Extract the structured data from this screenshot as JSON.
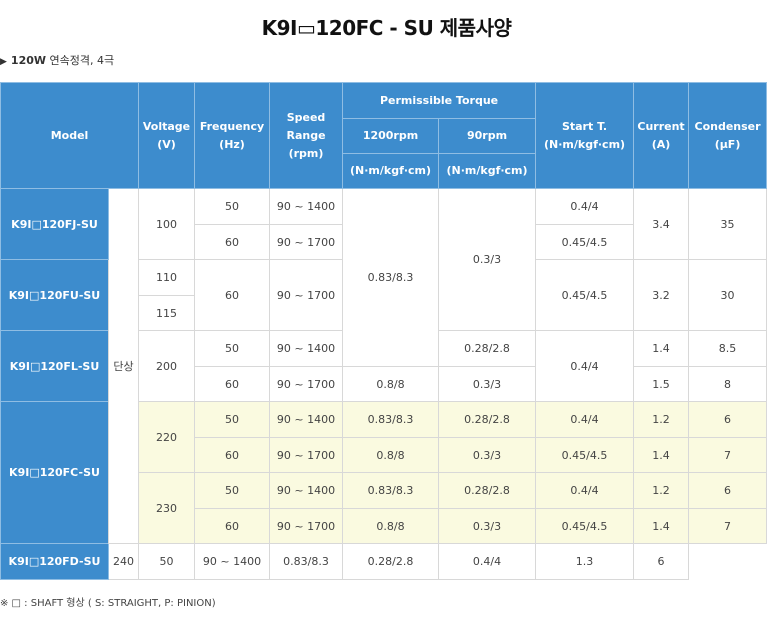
{
  "title": "K9I▭120FC - SU 제품사양",
  "subtitle": {
    "power": "120W",
    "desc": "연속정격, 4극"
  },
  "headers": {
    "model": "Model",
    "voltage": "Voltage",
    "voltage_unit": "(V)",
    "frequency": "Frequency",
    "frequency_unit": "(Hz)",
    "speed": "Speed",
    "speed_range": "Range",
    "speed_unit": "(rpm)",
    "permissible_torque": "Permissible Torque",
    "torque_1200": "1200rpm",
    "torque_90": "90rpm",
    "torque_unit_1200": "(N·m/kgf·cm)",
    "torque_unit_90": "(N·m/kgf·cm)",
    "start_t": "Start T.",
    "start_t_unit": "(N·m/kgf·cm)",
    "current": "Current",
    "current_unit": "(A)",
    "condenser": "Condenser",
    "condenser_unit": "(μF)"
  },
  "phase": "단상",
  "models": {
    "fj": "K9I□120FJ-SU",
    "fu": "K9I□120FU-SU",
    "fl": "K9I□120FL-SU",
    "fc": "K9I□120FC-SU",
    "fd": "K9I□120FD-SU"
  },
  "cells": {
    "fj_v": "100",
    "fj_f1": "50",
    "fj_s1": "90 ~ 1400",
    "fj_st1": "0.4/4",
    "fj_f2": "60",
    "fj_s2": "90 ~ 1700",
    "fj_st2": "0.45/4.5",
    "fj_cur": "3.4",
    "fj_cond": "35",
    "t1200_big": "0.83/8.3",
    "t90_big": "0.3/3",
    "fu_v1": "110",
    "fu_v2": "115",
    "fu_f": "60",
    "fu_s": "90 ~ 1700",
    "fu_st": "0.45/4.5",
    "fu_cur": "3.2",
    "fu_cond": "30",
    "fl_v": "200",
    "fl_f1": "50",
    "fl_s1": "90 ~ 1400",
    "fl_t90_1": "0.28/2.8",
    "fl_cur1": "1.4",
    "fl_cond1": "8.5",
    "fl_f2": "60",
    "fl_s2": "90 ~ 1700",
    "fl_t1200_2": "0.8/8",
    "fl_t90_2": "0.3/3",
    "fl_cur2": "1.5",
    "fl_cond2": "8",
    "fl_st": "0.4/4",
    "fc_v1": "220",
    "fc_r1_f": "50",
    "fc_r1_s": "90 ~ 1400",
    "fc_r1_t1200": "0.83/8.3",
    "fc_r1_t90": "0.28/2.8",
    "fc_r1_st": "0.4/4",
    "fc_r1_cur": "1.2",
    "fc_r1_cond": "6",
    "fc_r2_f": "60",
    "fc_r2_s": "90 ~ 1700",
    "fc_r2_t1200": "0.8/8",
    "fc_r2_t90": "0.3/3",
    "fc_r2_st": "0.45/4.5",
    "fc_r2_cur": "1.4",
    "fc_r2_cond": "7",
    "fc_v2": "230",
    "fc_r3_f": "50",
    "fc_r3_s": "90 ~ 1400",
    "fc_r3_t1200": "0.83/8.3",
    "fc_r3_t90": "0.28/2.8",
    "fc_r3_st": "0.4/4",
    "fc_r3_cur": "1.2",
    "fc_r3_cond": "6",
    "fc_r4_f": "60",
    "fc_r4_s": "90 ~ 1700",
    "fc_r4_t1200": "0.8/8",
    "fc_r4_t90": "0.3/3",
    "fc_r4_st": "0.45/4.5",
    "fc_r4_cur": "1.4",
    "fc_r4_cond": "7",
    "fd_v": "240",
    "fd_f": "50",
    "fd_s": "90 ~ 1400",
    "fd_t1200": "0.83/8.3",
    "fd_t90": "0.28/2.8",
    "fd_st": "0.4/4",
    "fd_cur": "1.3",
    "fd_cond": "6"
  },
  "note": "※ □ : SHAFT 형상 ( S: STRAIGHT, P: PINION)",
  "colors": {
    "header_blue": "#3d8ccd",
    "highlight_yellow": "#fafae0"
  }
}
